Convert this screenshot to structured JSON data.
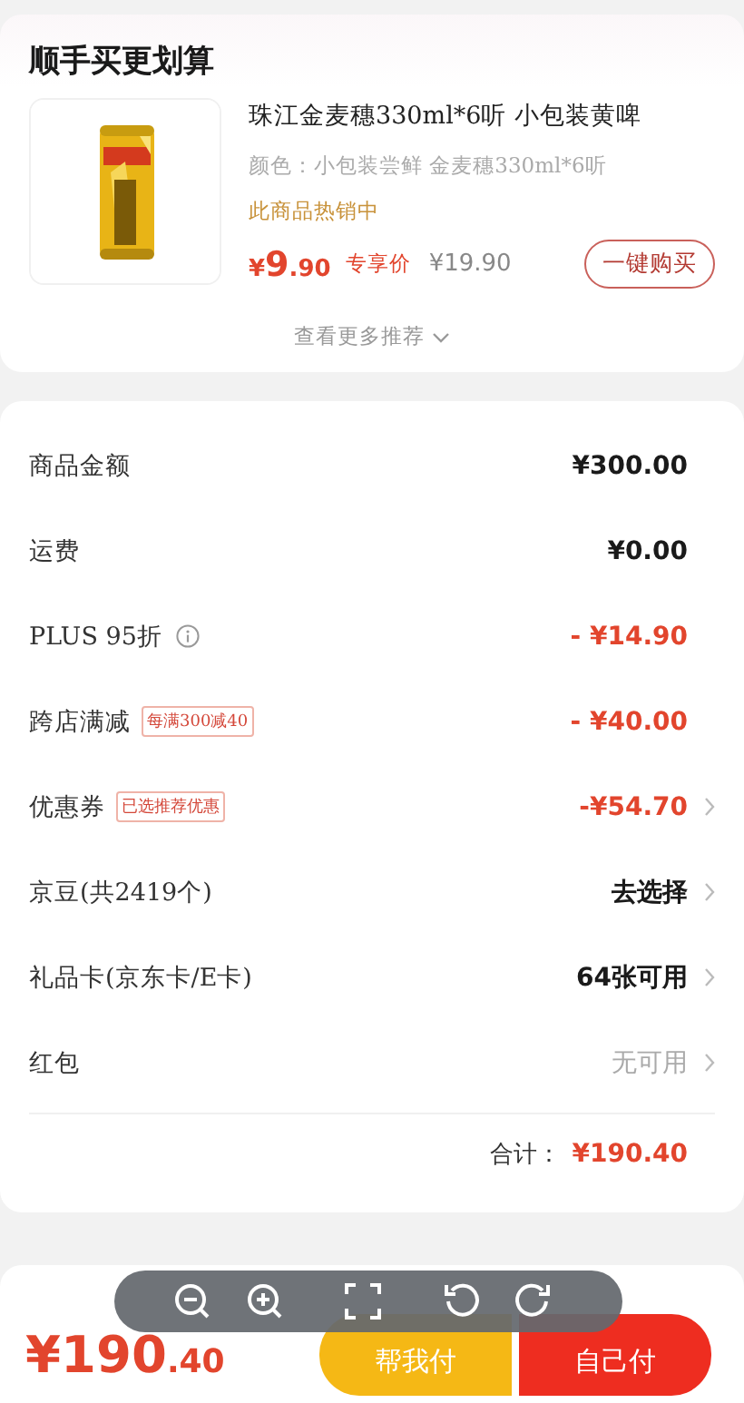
{
  "recommend": {
    "title": "顺手买更划算",
    "product": {
      "name": "珠江金麦穗330ml*6听 小包装黄啤",
      "spec": "颜色：小包装尝鲜 金麦穗330ml*6听",
      "hot_label": "此商品热销中",
      "price_symbol": "¥",
      "price_integer": "9",
      "price_decimal": ".90",
      "price_tag": "专享价",
      "original_price": "¥19.90",
      "buy_button": "一键购买"
    },
    "more_link": "查看更多推荐"
  },
  "fees": [
    {
      "label": "商品金额",
      "value": "¥300.00",
      "kind": "charge",
      "chevron": false
    },
    {
      "label": "运费",
      "value": "¥0.00",
      "kind": "charge",
      "chevron": false
    },
    {
      "label": "PLUS 95折",
      "info": true,
      "value": "- ¥14.90",
      "kind": "discount",
      "chevron": false
    },
    {
      "label": "跨店满减",
      "tag": "每满300减40",
      "value": "- ¥40.00",
      "kind": "discount",
      "chevron": false
    },
    {
      "label": "优惠券",
      "tag": "已选推荐优惠",
      "value": "-¥54.70",
      "kind": "discount",
      "chevron": true
    },
    {
      "label": "京豆(共2419个)",
      "value": "去选择",
      "kind": "charge",
      "chevron": true
    },
    {
      "label": "礼品卡(京东卡/E卡)",
      "value": "64张可用",
      "kind": "charge",
      "chevron": true
    },
    {
      "label": "红包",
      "value": "无可用",
      "kind": "unavailable",
      "chevron": true
    }
  ],
  "total": {
    "label": "合计：",
    "amount": "¥190.40"
  },
  "bottom_bar": {
    "amount_integer": "¥190",
    "amount_decimal": ".40",
    "buttons": [
      {
        "label": "帮我付",
        "kind": "secondary"
      },
      {
        "label": "自己付",
        "kind": "primary"
      }
    ]
  },
  "viewer_toolbar": {
    "tools": [
      {
        "kind": "zoom-out"
      },
      {
        "kind": "zoom-in"
      },
      {
        "kind": "fullscreen"
      },
      {
        "kind": "rotate-left"
      },
      {
        "kind": "rotate-right"
      }
    ]
  }
}
